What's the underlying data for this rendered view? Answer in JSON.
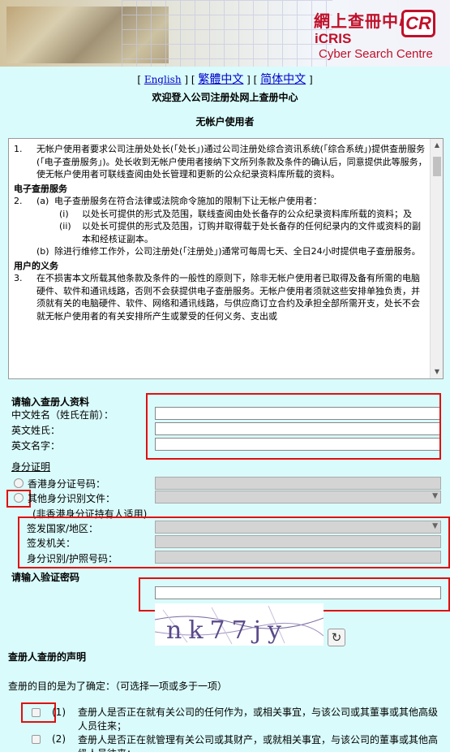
{
  "banner": {
    "cn_title": "網上查冊中心",
    "logo_text": "CR",
    "en_abbr": "iCRIS",
    "en_name": "Cyber Search Centre"
  },
  "lang": {
    "english": "English",
    "trad": "繁體中文",
    "simp": "简体中文"
  },
  "welcome": "欢迎登入公司注册处网上查册中心",
  "subtitle": "无帐户使用者",
  "terms": {
    "item1_num": "1.",
    "item1_text": "无帐户使用者要求公司注册处处长(「处长」)通过公司注册处综合资讯系统(「综合系统」)提供查册服务(「电子查册服务」)。处长收到无帐户使用者接纳下文所列条款及条件的确认后，同意提供此等服务，使无帐户使用者可联线查阅由处长管理和更新的公众纪录资料库所载的资料。",
    "heading1": "电子查册服务",
    "item2_num": "2.",
    "item2a_label": "(a)",
    "item2a_text": "电子查册服务在符合法律或法院命令施加的限制下让无帐户使用者：",
    "item2a_i_label": "(i)",
    "item2a_i_text": "以处长可提供的形式及范围，联线查阅由处长备存的公众纪录资料库所载的资料；及",
    "item2a_ii_label": "(ii)",
    "item2a_ii_text": "以处长可提供的形式及范围，订购并取得载于处长备存的任何纪录内的文件或资料的副本和经核证副本。",
    "item2b_label": "(b)",
    "item2b_text": "除进行维修工作外，公司注册处(「注册处」)通常可每周七天、全日24小时提供电子查册服务。",
    "heading2": "用户的义务",
    "item3_num": "3.",
    "item3_text": "在不损害本文所载其他条款及条件的一般性的原则下，除非无帐户使用者已取得及备有所需的电脑硬件、软件和通讯线路，否则不会获提供电子查册服务。无帐户使用者须就这些安排单独负责，并须就有关的电脑硬件、软件、网络和通讯线路，与供应商订立合约及承担全部所需开支，处长不会就无帐户使用者的有关安排所产生或蒙受的任何义务、支出或"
  },
  "searcher": {
    "heading": "请输入查册人资料",
    "cn_name_label": "中文姓名（姓氏在前）：",
    "en_surname_label": "英文姓氏：",
    "en_given_label": "英文名字：",
    "cn_name_value": "",
    "en_surname_value": "",
    "en_given_value": ""
  },
  "identity": {
    "heading": "身分证明",
    "hkid_label": "香港身分证号码：",
    "other_label": "其他身分识别文件：",
    "other_note": "(非香港身分证持有人适用)",
    "country_label": "签发国家/地区：",
    "authority_label": "签发机关：",
    "doc_no_label": "身分识别/护照号码："
  },
  "captcha": {
    "heading": "请输入验证密码",
    "value": "",
    "image_text": "nk77jy"
  },
  "declaration": {
    "heading": "查册人查册的声明",
    "purpose": "查册的目的是为了确定：（可选择一项或多于一项）",
    "opt1_label": "(1)",
    "opt1_text": "查册人是否正在就有关公司的任何作为，或相关事宜，与该公司或其董事或其他高级人员往来；",
    "opt2_label": "(2)",
    "opt2_text": "查册人是否正在就管理有关公司或其财产，或就相关事宜，与该公司的董事或其他高级人员往来；"
  }
}
